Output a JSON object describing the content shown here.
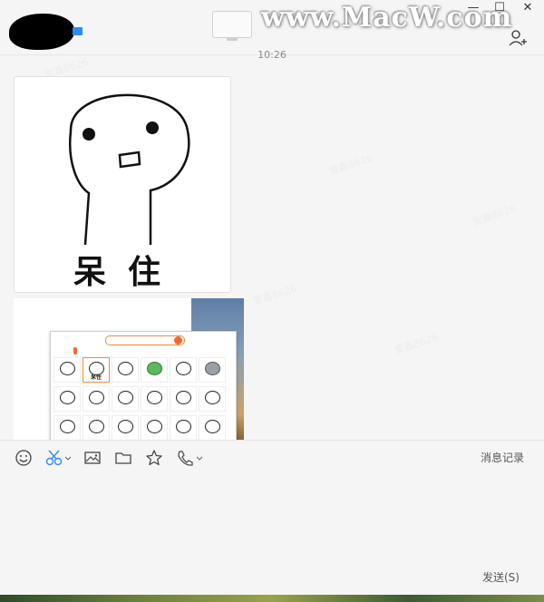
{
  "window": {
    "watermark": "www.MacW.com",
    "minimize_glyph": "—",
    "maximize_glyph": "☐",
    "close_glyph": "✕"
  },
  "chat": {
    "timestamp": "10:26",
    "messages": [
      {
        "type": "sticker",
        "caption": "呆住"
      },
      {
        "type": "screenshot"
      }
    ],
    "ghost_watermark": "爱鑫8626"
  },
  "toolbar": {
    "icons": [
      "smiley-icon",
      "scissors-icon",
      "image-icon",
      "folder-icon",
      "star-icon",
      "phone-icon"
    ],
    "history_label": "消息记录"
  },
  "composer": {
    "send_label": "发送(S)"
  },
  "colors": {
    "accent_blue": "#2c8cf4",
    "panel_orange": "#f06a2c",
    "background": "#f5f5f5"
  }
}
